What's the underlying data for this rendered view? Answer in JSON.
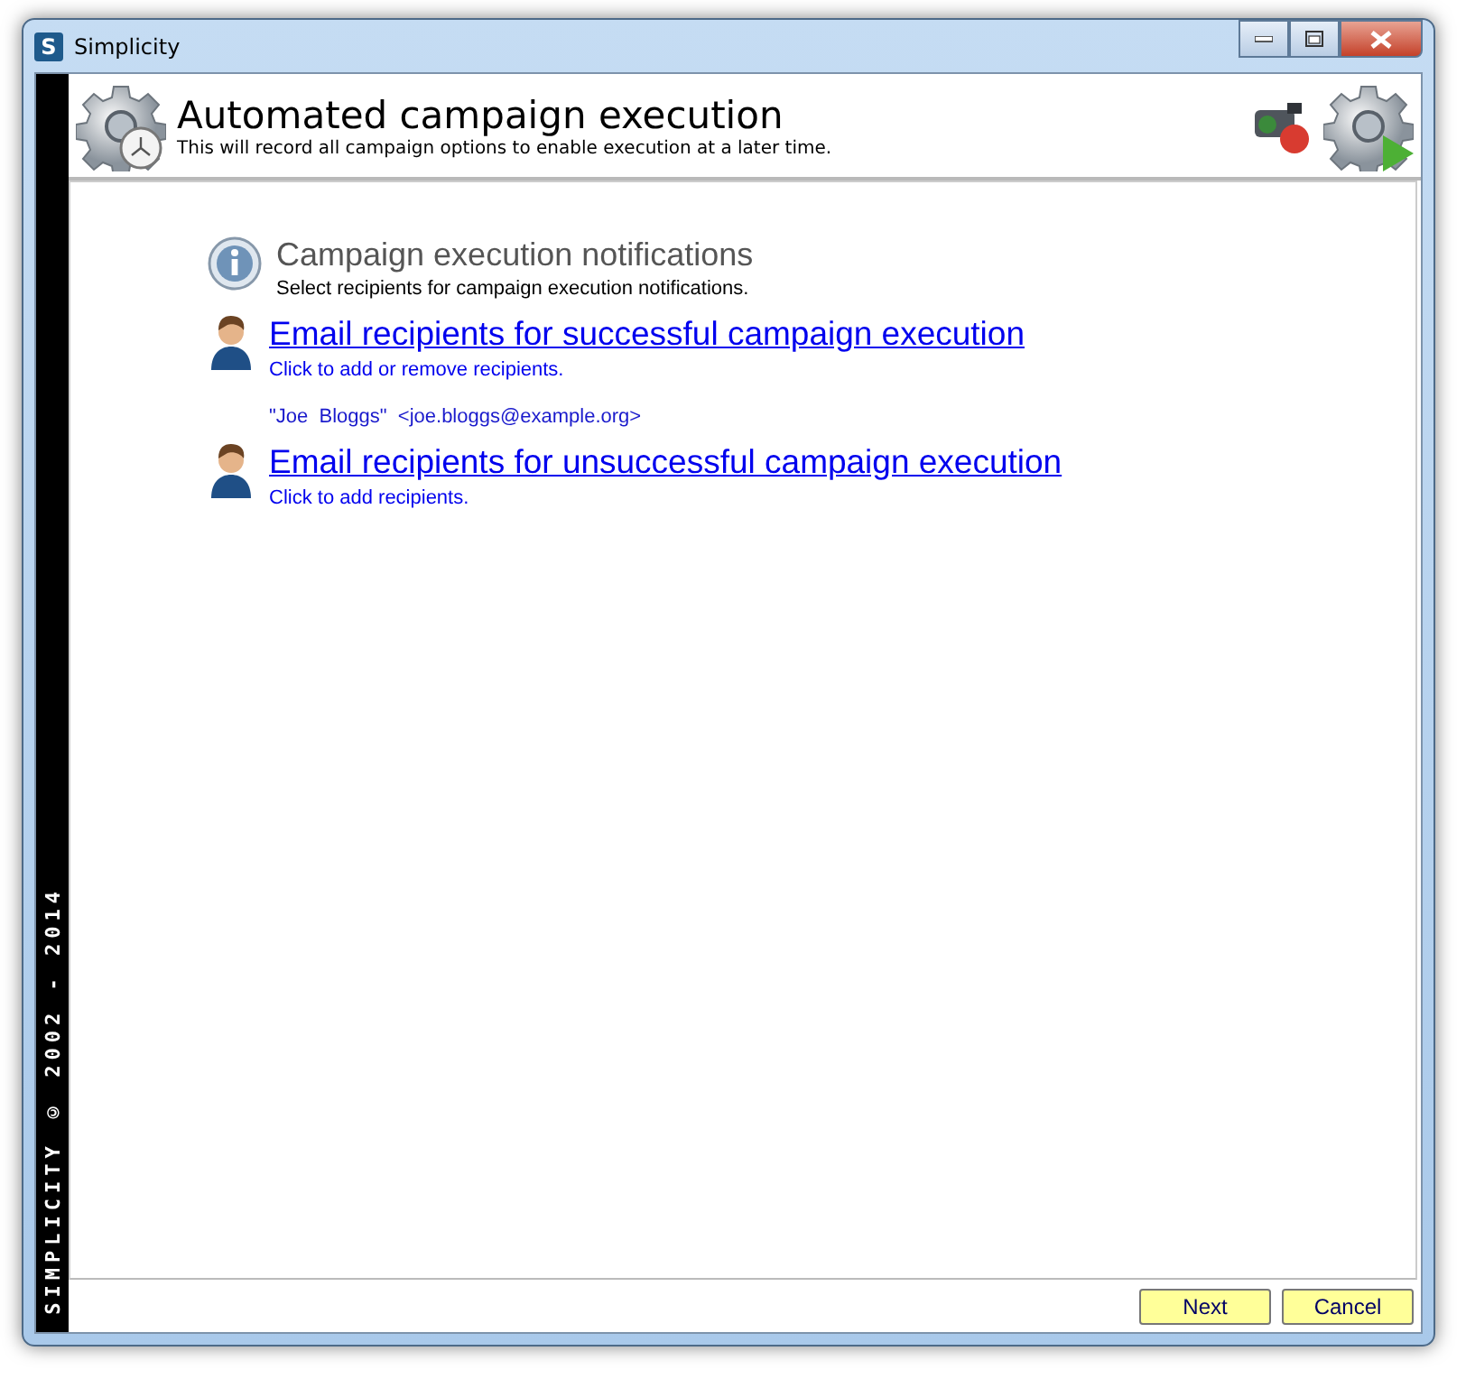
{
  "window": {
    "title": "Simplicity",
    "app_icon_letter": "S"
  },
  "header": {
    "title": "Automated campaign execution",
    "subtitle": "This will record all campaign options to enable execution at a later time."
  },
  "sidebar": {
    "text": "SIMPLICITY © 2002 - 2014"
  },
  "section": {
    "title": "Campaign execution notifications",
    "description": "Select recipients for campaign execution notifications."
  },
  "links": [
    {
      "title": "Email recipients for successful campaign execution",
      "hint": "Click to add or remove recipients.",
      "recipients": [
        "\"Joe  Bloggs\"  <joe.bloggs@example.org>"
      ]
    },
    {
      "title": "Email recipients for unsuccessful campaign execution",
      "hint": "Click to add recipients."
    }
  ],
  "buttons": [
    "Next",
    "Cancel"
  ]
}
